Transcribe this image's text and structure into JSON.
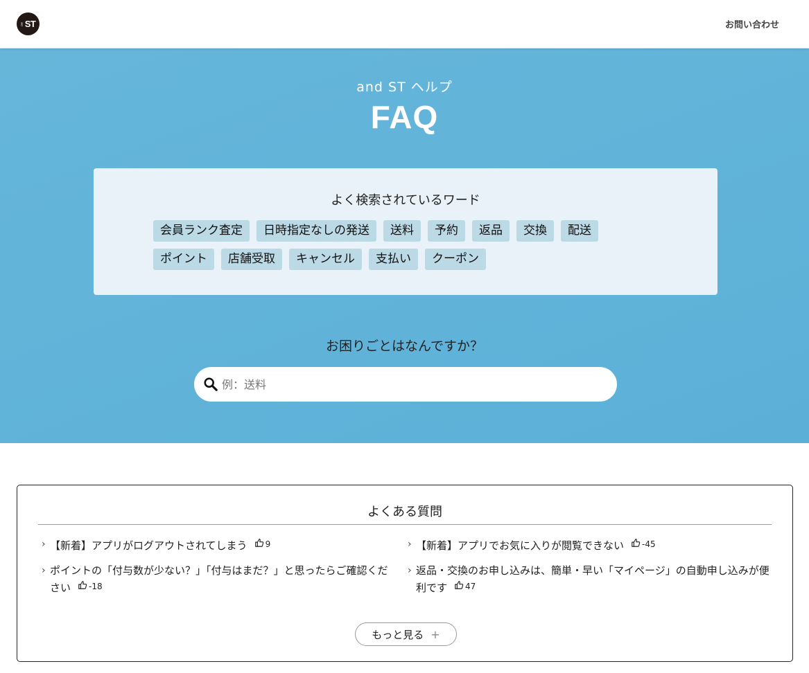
{
  "header": {
    "logo_small": "and",
    "logo_text": "ST",
    "contact_link": "お問い合わせ"
  },
  "hero": {
    "subtitle": "and ST ヘルプ",
    "title": "FAQ"
  },
  "keywords": {
    "title": "よく検索されているワード",
    "row1": [
      "会員ランク査定",
      "日時指定なしの発送",
      "送料",
      "予約",
      "返品",
      "交換",
      "配送"
    ],
    "row2": [
      "ポイント",
      "店舗受取",
      "キャンセル",
      "支払い",
      "クーポン"
    ]
  },
  "search": {
    "title": "お困りごとはなんですか？",
    "placeholder": "例：送料"
  },
  "faq": {
    "title": "よくある質問",
    "items": [
      {
        "text": "【新着】アプリがログアウトされてしまう",
        "likes": "9"
      },
      {
        "text": "【新着】アプリでお気に入りが閲覧できない",
        "likes": "-45"
      },
      {
        "text": "ポイントの「付与数が少ない？」「付与はまだ？」と思ったらご確認ください",
        "likes": "-18"
      },
      {
        "text": "返品・交換のお申し込みは、簡単・早い「マイページ」の自動申し込みが便利です",
        "likes": "47"
      }
    ],
    "more_label": "もっと見る",
    "more_icon": "+"
  },
  "colors": {
    "hero_bg": "#5fb3da",
    "keyword_box_bg": "#e8f2f8",
    "tag_bg": "#bcd9e6",
    "logo_bg": "#231815"
  }
}
